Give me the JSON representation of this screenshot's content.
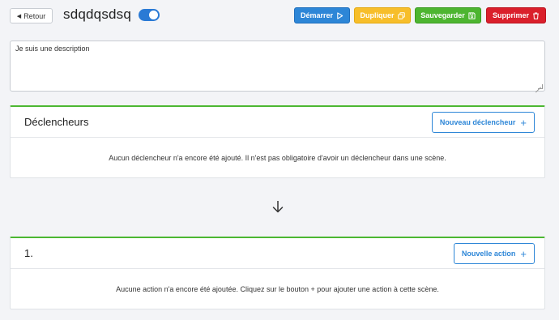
{
  "topbar": {
    "back_label": "Retour",
    "scene_name": "sdqdqsdsq",
    "toggle_on": true,
    "buttons": {
      "start": "Démarrer",
      "duplicate": "Dupliquer",
      "save": "Sauvegarder",
      "delete": "Supprimer"
    }
  },
  "description": {
    "value": "Je suis une description"
  },
  "triggers": {
    "title": "Déclencheurs",
    "new_button": "Nouveau déclencheur",
    "empty_text": "Aucun déclencheur n'a encore été ajouté. Il n'est pas obligatoire d'avoir un déclencheur dans une scène."
  },
  "actions": {
    "title": "1.",
    "new_button": "Nouvelle action",
    "empty_text": "Aucune action n'a encore été ajoutée. Cliquez sur le bouton + pour ajouter une action à cette scène."
  },
  "colors": {
    "primary": "#2d86d7",
    "warning": "#f7be2a",
    "success": "#4db530",
    "danger": "#da1f2b",
    "panel_accent": "#4cb732"
  },
  "icons": {
    "back": "caret-left-icon",
    "start": "play-icon",
    "duplicate": "copy-icon",
    "save": "floppy-disk-icon",
    "delete": "trash-icon",
    "add": "plus-icon",
    "flow": "arrow-down-icon"
  }
}
